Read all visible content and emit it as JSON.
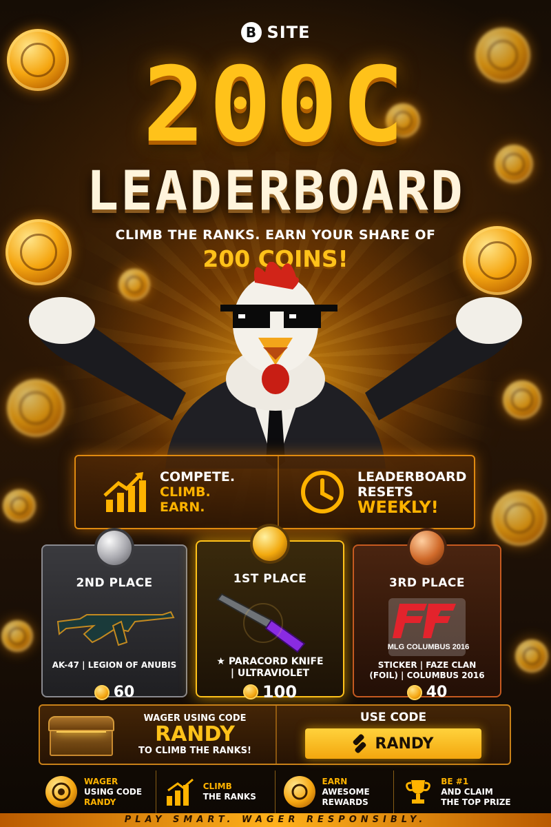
{
  "brand": {
    "logo_letter": "B",
    "name": "SITE"
  },
  "hero": {
    "amount": "200C",
    "title": "LEADERBOARD",
    "tagline": "CLIMB THE RANKS. EARN YOUR SHARE OF",
    "tagline_strong": "200 COINS!"
  },
  "info_bar": {
    "left": {
      "icon": "chart-arrow-icon",
      "line1": "COMPETE.",
      "line2": "CLIMB.",
      "line3": "EARN."
    },
    "right": {
      "icon": "clock-icon",
      "line1": "LEADERBOARD",
      "line2": "RESETS",
      "line3": "WEEKLY!"
    }
  },
  "prizes": {
    "second": {
      "place": "2ND PLACE",
      "item": "AK-47 | LEGION OF ANUBIS",
      "value": "60",
      "medal": "silver"
    },
    "first": {
      "place": "1ST PLACE",
      "item_line1": "★ PARACORD KNIFE",
      "item_line2": "| ULTRAVIOLET",
      "value": "100",
      "medal": "gold"
    },
    "third": {
      "place": "3RD PLACE",
      "item_line1": "STICKER | FAZE CLAN",
      "item_line2": "(FOIL) | COLUMBUS 2016",
      "value": "40",
      "medal": "bronze",
      "sticker_logo": "FaZe",
      "sticker_caption": "MLG COLUMBUS 2016"
    }
  },
  "code_banner": {
    "left_top": "WAGER USING CODE",
    "code": "RANDY",
    "left_bottom": "TO CLIMB THE RANKS!",
    "right_label": "USE CODE",
    "button_label": "RANDY"
  },
  "steps": [
    {
      "icon": "target-icon",
      "accent": "WAGER",
      "line2": "USING CODE",
      "line3": "RANDY"
    },
    {
      "icon": "bar-chart-icon",
      "accent": "CLIMB",
      "line2": "THE RANKS",
      "line3": ""
    },
    {
      "icon": "coin-icon",
      "accent": "EARN",
      "line2": "AWESOME",
      "line3": "REWARDS"
    },
    {
      "icon": "trophy-icon",
      "accent": "BE #1",
      "line2": "AND CLAIM",
      "line3": "THE TOP PRIZE"
    }
  ],
  "footer": "PLAY SMART. WAGER RESPONSIBLY.",
  "colors": {
    "accent": "#ffc21a",
    "orange": "#f5a611",
    "border": "#e08a10"
  }
}
